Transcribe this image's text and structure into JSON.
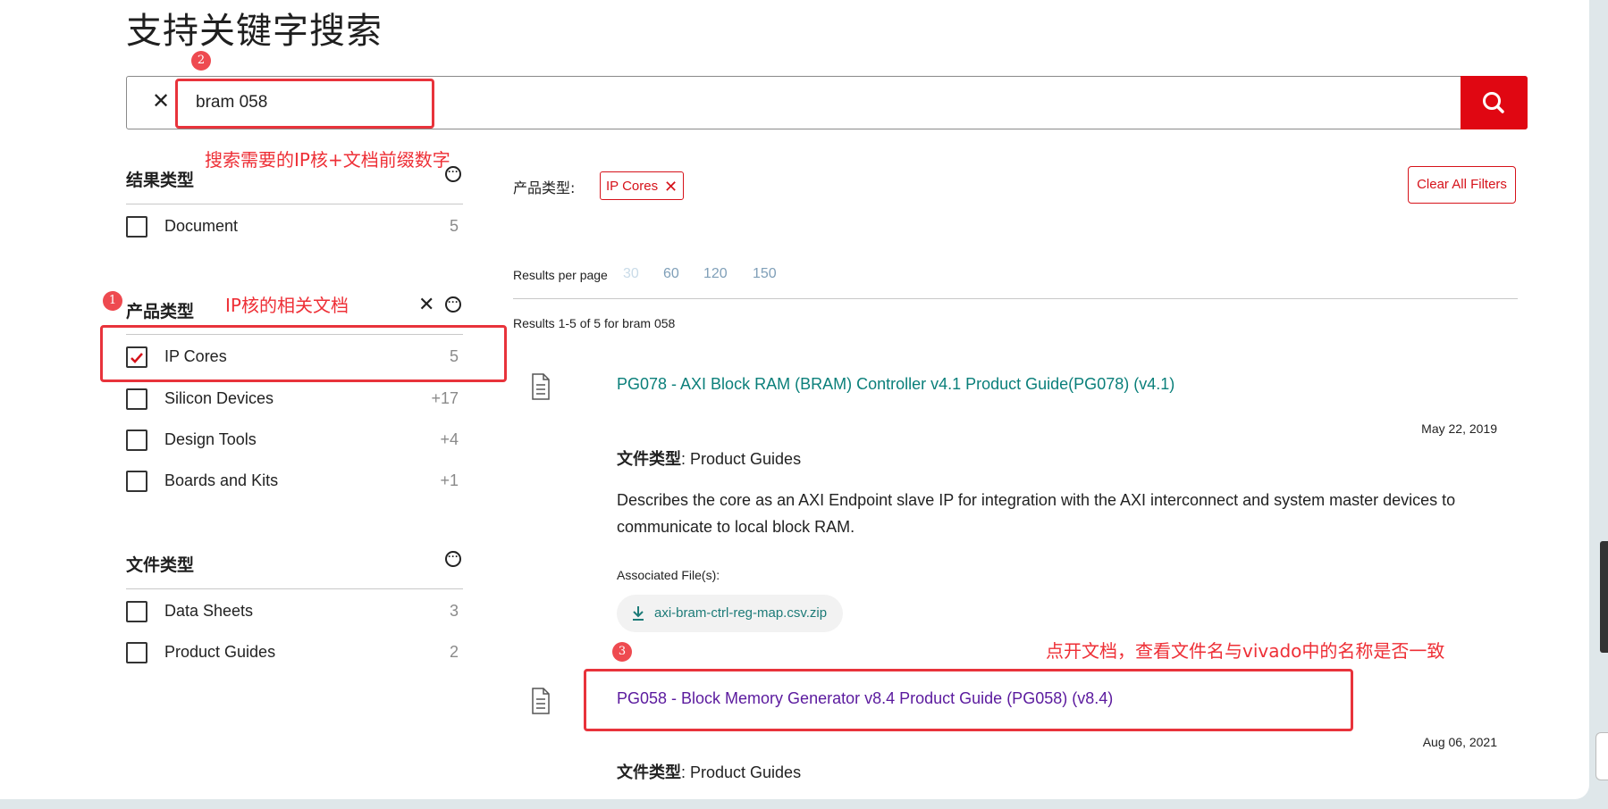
{
  "page": {
    "title": "支持关键字搜索"
  },
  "search": {
    "value": "bram 058",
    "clear_symbol": "✕"
  },
  "colors": {
    "accent": "#e00712",
    "link_teal": "#0a7f7a",
    "link_visited": "#5b1a9e",
    "annotation": "#e8333b"
  },
  "annotations": [
    {
      "number": "1",
      "note": "IP核的相关文档"
    },
    {
      "number": "2",
      "note": "搜索需要的IP核+文档前缀数字"
    },
    {
      "number": "3",
      "note": "点开文档，查看文件名与vivado中的名称是否一致"
    }
  ],
  "sidebar": {
    "result_type": {
      "title": "结果类型",
      "items": [
        {
          "label": "Document",
          "count": "5",
          "checked": false
        }
      ]
    },
    "product_type": {
      "title": "产品类型",
      "items": [
        {
          "label": "IP Cores",
          "count": "5",
          "checked": true
        },
        {
          "label": "Silicon Devices",
          "count": "+17",
          "checked": false
        },
        {
          "label": "Design Tools",
          "count": "+4",
          "checked": false
        },
        {
          "label": "Boards and Kits",
          "count": "+1",
          "checked": false
        }
      ]
    },
    "file_type": {
      "title": "文件类型",
      "items": [
        {
          "label": "Data Sheets",
          "count": "3",
          "checked": false
        },
        {
          "label": "Product Guides",
          "count": "2",
          "checked": false
        }
      ]
    }
  },
  "filters": {
    "label": "产品类型:",
    "active_chip": "IP Cores",
    "clear_all": "Clear All Filters"
  },
  "results_per_page": {
    "label": "Results per page",
    "options": [
      "30",
      "60",
      "120",
      "150"
    ],
    "selected": "30"
  },
  "summary": "Results 1-5 of 5 for bram 058",
  "results": [
    {
      "title": "PG078 - AXI Block RAM (BRAM) Controller v4.1 Product Guide(PG078) (v4.1)",
      "date": "May 22, 2019",
      "file_type_label": "文件类型",
      "file_type": ": Product Guides",
      "description": "Describes the core as an AXI Endpoint slave IP for integration with the AXI interconnect and system master devices to communicate to local block RAM.",
      "associated_label": "Associated File(s):",
      "associated_file": "axi-bram-ctrl-reg-map.csv.zip"
    },
    {
      "title": "PG058 - Block Memory Generator v8.4 Product Guide (PG058) (v8.4)",
      "date": "Aug 06, 2021",
      "file_type_label": "文件类型",
      "file_type": ": Product Guides"
    }
  ]
}
